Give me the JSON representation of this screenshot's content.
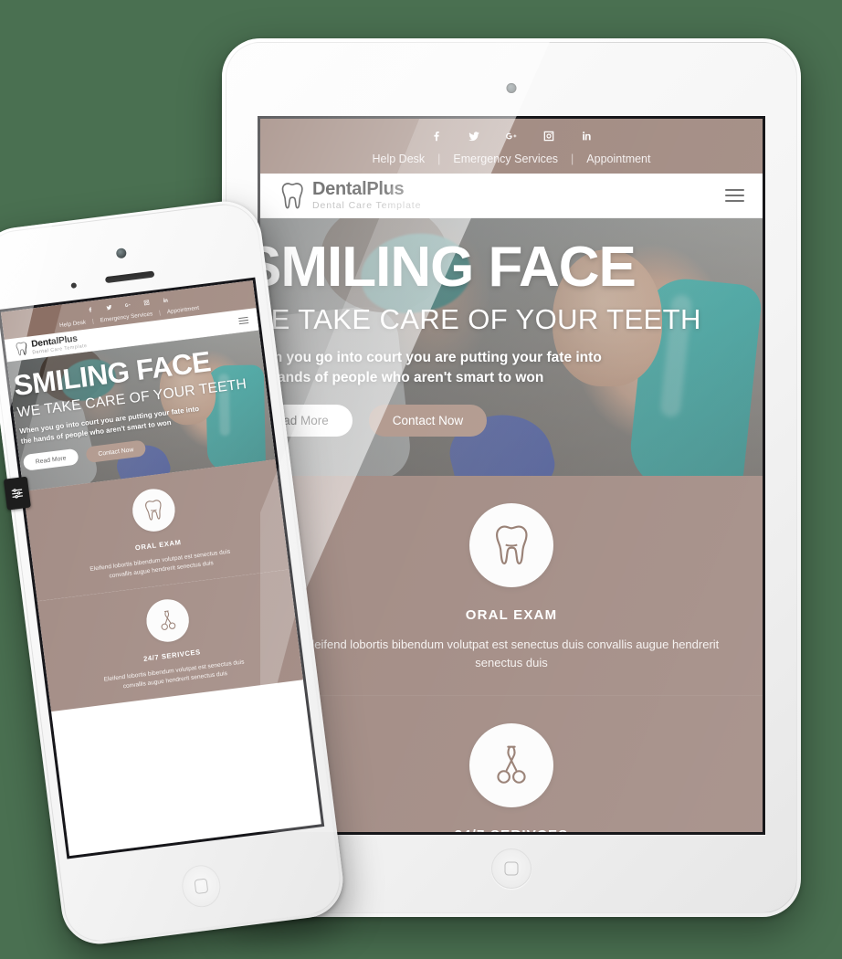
{
  "page": {
    "background_color": "#4a7051",
    "devices": [
      "tablet",
      "phone"
    ]
  },
  "site": {
    "topbar": {
      "background_color": "#8c7065",
      "social": [
        {
          "name": "facebook-icon",
          "label": "f"
        },
        {
          "name": "twitter-icon",
          "label": "t"
        },
        {
          "name": "google-plus-icon",
          "label": "G+"
        },
        {
          "name": "instagram-icon",
          "label": "ig"
        },
        {
          "name": "linkedin-icon",
          "label": "in"
        }
      ],
      "links": [
        "Help Desk",
        "Emergency Services",
        "Appointment"
      ],
      "separator": "|"
    },
    "navbar": {
      "brand_name": "DentalPlus",
      "brand_tagline": "Dental Care Template",
      "logo_icon": "tooth-icon",
      "menu_icon": "hamburger-menu-icon"
    },
    "hero": {
      "title": "SMILING FACE",
      "subtitle": "WE TAKE CARE OF YOUR TEETH",
      "paragraph": "When you go into court you are putting your fate into the hands of people who aren't smart to won",
      "primary_button": "Read More",
      "secondary_button": "Contact Now",
      "secondary_button_color": "#a08274"
    },
    "services": [
      {
        "icon": "tooth-icon",
        "title": "ORAL EXAM",
        "text": "Eleifend lobortis bibendum volutpat est senectus duis convallis augue hendrerit senectus duis"
      },
      {
        "icon": "dental-forceps-icon",
        "title": "24/7 SERIVCES",
        "text": "Eleifend lobortis bibendum volutpat est senectus duis convallis augue hendrerit senectus duis"
      }
    ],
    "section_background_color": "#8d7168"
  },
  "phone": {
    "side_widget_icon": "settings-sliders-icon",
    "home_button_icon": "rounded-square-icon"
  },
  "tablet": {
    "home_button_icon": "rounded-square-icon",
    "camera_icon": "front-camera-icon"
  }
}
